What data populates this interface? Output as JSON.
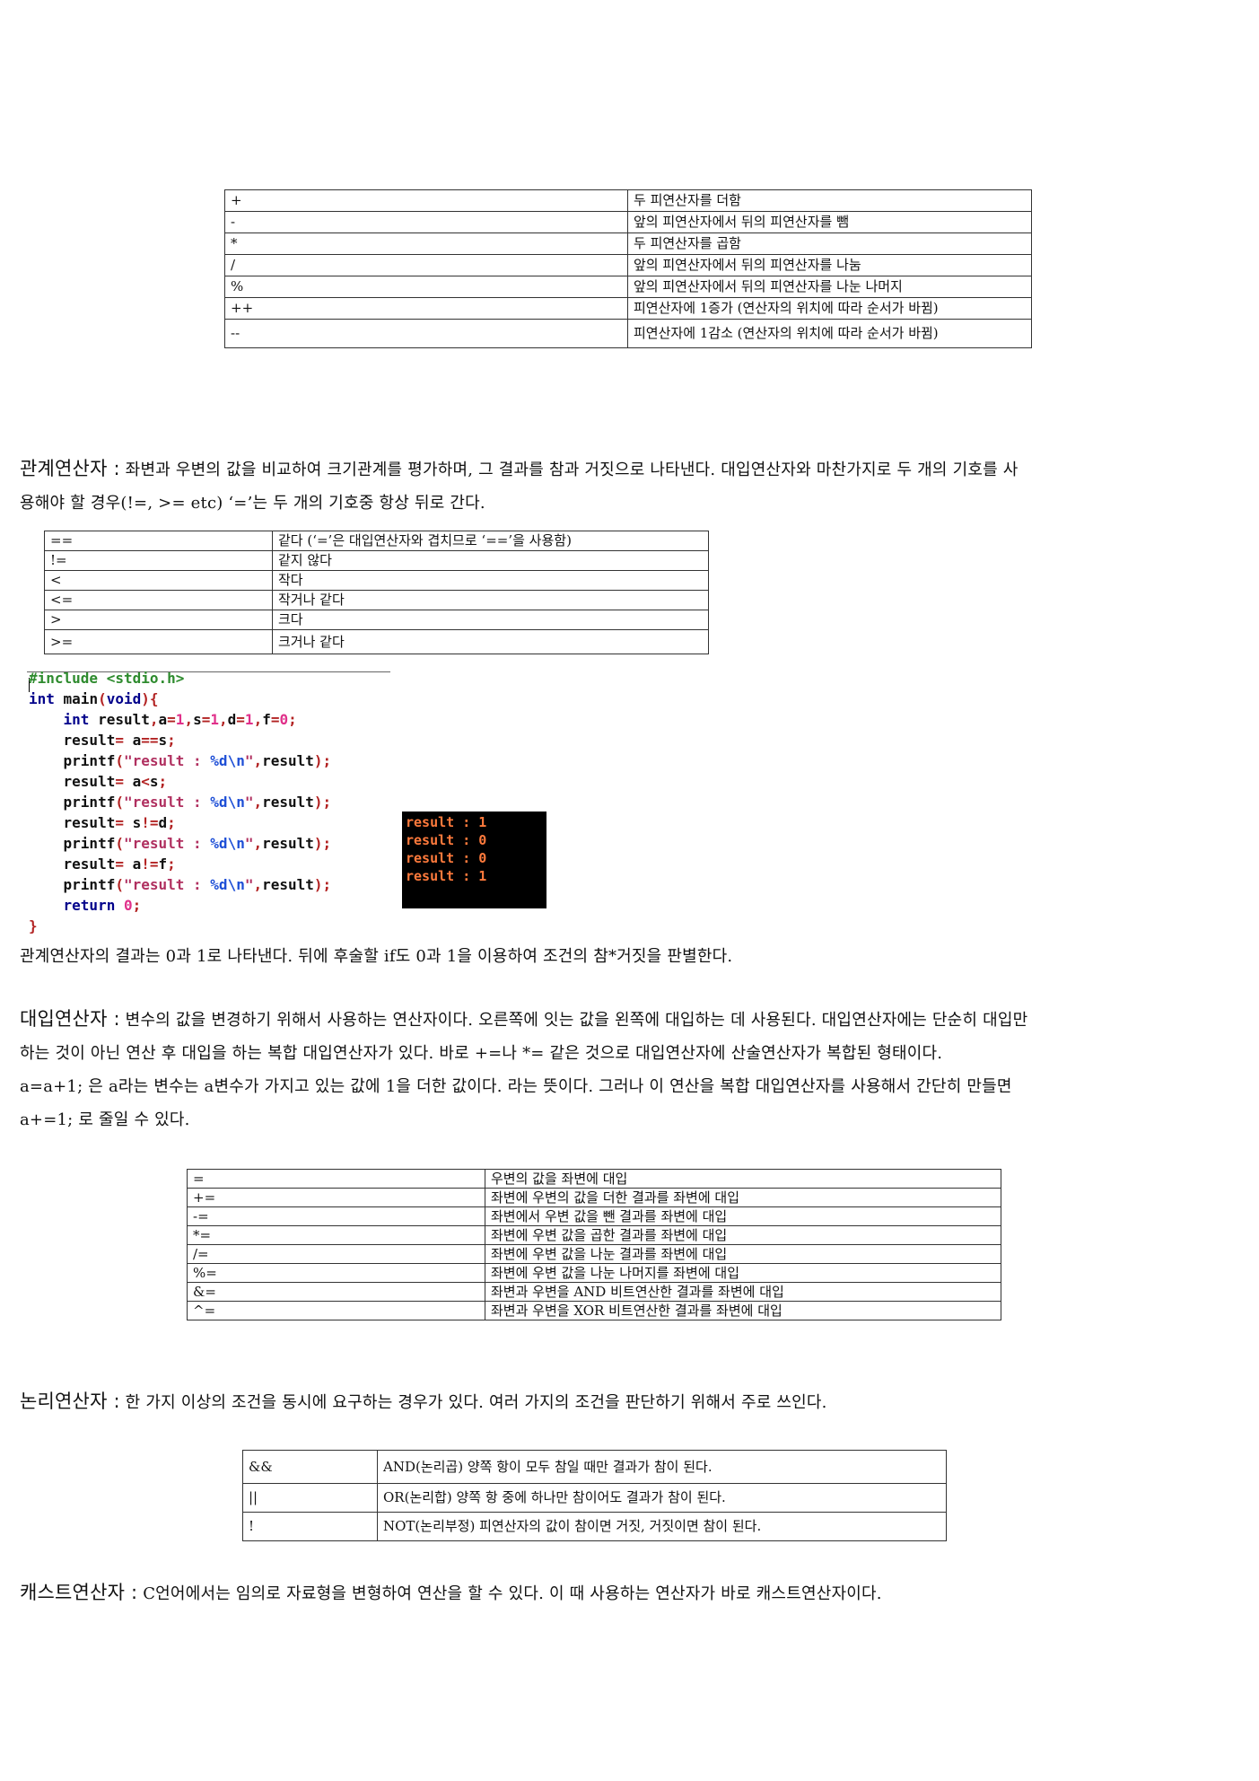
{
  "arith_table": [
    [
      "+",
      "두 피연산자를 더함"
    ],
    [
      "-",
      "앞의 피연산자에서 뒤의 피연산자를 뺌"
    ],
    [
      "*",
      "두 피연산자를 곱함"
    ],
    [
      "/",
      "앞의 피연산자에서 뒤의 피연산자를 나눔"
    ],
    [
      "%",
      "앞의 피연산자에서 뒤의 피연산자를 나눈 나머지"
    ],
    [
      "++",
      "피연산자에 1증가 (연산자의 위치에 따라 순서가 바뀜)"
    ],
    [
      "--",
      "피연산자에 1감소 (연산자의 위치에 따라 순서가 바뀜)"
    ]
  ],
  "relational": {
    "heading": "관계연산자 :",
    "text1": " 좌변과 우변의 값을 비교하여 크기관계를 평가하며, 그 결과를 참과 거짓으로 나타낸다. 대입연산자와 마찬가지로 두 개의 기호를 사",
    "text2": "용해야 할 경우(!=, >= etc) ‘=’는 두 개의 기호중 항상 뒤로 간다.",
    "table": [
      [
        "==",
        "같다 (‘=’은 대입연산자와 겹치므로 ‘==’을 사용함)"
      ],
      [
        "!=",
        "같지 않다"
      ],
      [
        "<",
        "작다"
      ],
      [
        "<=",
        "작거나 같다"
      ],
      [
        ">",
        "크다"
      ],
      [
        ">=",
        "크거나 같다"
      ]
    ],
    "result_text": "관계연산자의 결과는 0과 1로 나타낸다. 뒤에 후술할 if도 0과 1을 이용하여 조건의 참*거짓을 판별한다."
  },
  "code": {
    "include": "#include <stdio.h>",
    "lines": [
      "int main(void){",
      "    int result,a=1,s=1,d=1,f=0;",
      "    result= a==s;",
      "    printf(\"result : %d\\n\",result);",
      "    result= a<s;",
      "    printf(\"result : %d\\n\",result);",
      "    result= s!=d;",
      "    printf(\"result : %d\\n\",result);",
      "    result= a!=f;",
      "    printf(\"result : %d\\n\",result);",
      "    return 0;",
      "}"
    ]
  },
  "console_output": [
    "result : 1",
    "result : 0",
    "result : 0",
    "result : 1"
  ],
  "assignment": {
    "heading": "대입연산자 :",
    "text1": " 변수의 값을 변경하기 위해서 사용하는 연산자이다. 오른쪽에 잇는 값을 왼쪽에 대입하는 데 사용된다. 대입연산자에는 단순히 대입만",
    "text2": "하는 것이 아닌 연산 후 대입을 하는 복합 대입연산자가 있다. 바로 +=나 *= 같은 것으로 대입연산자에 산술연산자가 복합된 형태이다.",
    "text3": "a=a+1; 은 a라는 변수는 a변수가 가지고 있는 값에 1을 더한 값이다. 라는 뜻이다. 그러나 이 연산을 복합 대입연산자를 사용해서 간단히 만들면",
    "text4": "a+=1; 로 줄일 수 있다.",
    "table": [
      [
        "=",
        "우변의 값을 좌변에 대입"
      ],
      [
        "+=",
        "좌변에 우변의 값을 더한 결과를 좌변에 대입"
      ],
      [
        "-=",
        "좌변에서 우변 값을 뺀 결과를 좌변에 대입"
      ],
      [
        "*=",
        "좌변에 우변 값을 곱한 결과를 좌변에 대입"
      ],
      [
        "/=",
        "좌변에 우변 값을 나눈 결과를 좌변에 대입"
      ],
      [
        "%=",
        "좌변에 우변 값을 나눈 나머지를 좌변에 대입"
      ],
      [
        "&=",
        "좌변과 우변을 AND 비트연산한 결과를 좌변에 대입"
      ],
      [
        "^=",
        "좌변과 우변을 XOR 비트연산한 결과를 좌변에 대입"
      ]
    ]
  },
  "logical": {
    "heading": "논리연산자 :",
    "text": " 한 가지 이상의 조건을 동시에 요구하는 경우가 있다. 여러 가지의 조건을 판단하기 위해서 주로 쓰인다.",
    "table": [
      [
        "&&",
        "AND(논리곱) 양쪽 항이 모두 참일 때만 결과가 참이 된다."
      ],
      [
        "||",
        "OR(논리합) 양쪽 항 중에 하나만 참이어도 결과가 참이 된다."
      ],
      [
        "!",
        "NOT(논리부정) 피연산자의 값이 참이면 거짓, 거짓이면 참이 된다."
      ]
    ]
  },
  "cast": {
    "heading": "캐스트연산자 :",
    "text": " C언어에서는 임의로 자료형을 변형하여 연산을 할 수 있다. 이 때 사용하는 연산자가 바로 캐스트연산자이다."
  }
}
